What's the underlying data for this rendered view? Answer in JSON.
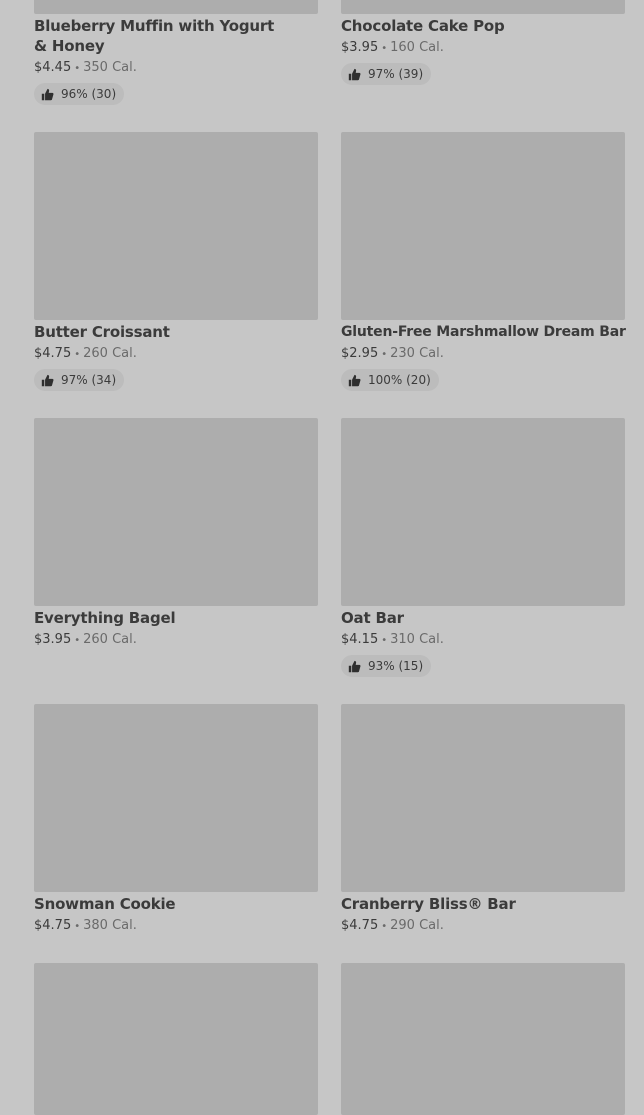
{
  "products": [
    {
      "name": "Blueberry Muffin with Yogurt & Honey",
      "price": "$4.45",
      "calories": "350 Cal.",
      "rating": "96% (30)"
    },
    {
      "name": "Chocolate Cake Pop",
      "price": "$3.95",
      "calories": "160 Cal.",
      "rating": "97% (39)"
    },
    {
      "name": "Butter Croissant",
      "price": "$4.75",
      "calories": "260 Cal.",
      "rating": "97% (34)"
    },
    {
      "name": "Gluten-Free Marshmallow Dream Bar",
      "price": "$2.95",
      "calories": "230 Cal.",
      "rating": "100% (20)"
    },
    {
      "name": "Everything Bagel",
      "price": "$3.95",
      "calories": "260 Cal."
    },
    {
      "name": "Oat Bar",
      "price": "$4.15",
      "calories": "310 Cal.",
      "rating": "93% (15)"
    },
    {
      "name": "Snowman Cookie",
      "price": "$4.75",
      "calories": "380 Cal."
    },
    {
      "name": "Cranberry Bliss® Bar",
      "price": "$4.75",
      "calories": "290 Cal."
    }
  ],
  "separator": "•",
  "icons": {
    "rating": "thumbs-up-icon"
  }
}
